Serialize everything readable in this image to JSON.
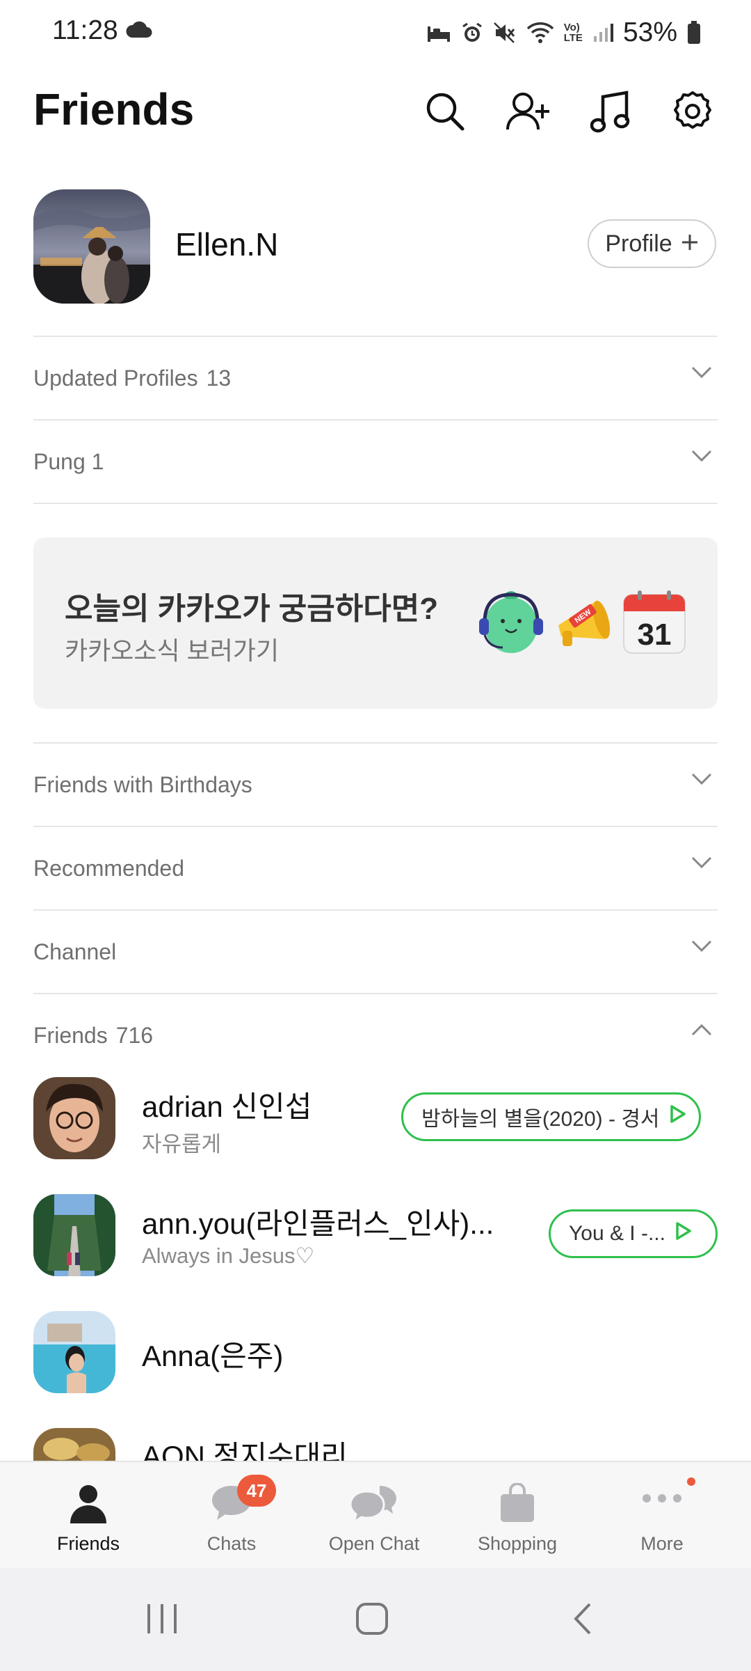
{
  "status_bar": {
    "time": "11:28",
    "battery_percent": "53%",
    "icons": [
      "cloud-icon",
      "sleep-icon",
      "alarm-icon",
      "mute-icon",
      "wifi-icon",
      "volte-icon",
      "signal-icon",
      "battery-icon"
    ],
    "volte_text": "VoLTE"
  },
  "header": {
    "title": "Friends",
    "actions": [
      "search-icon",
      "add-friend-icon",
      "music-icon",
      "settings-icon"
    ]
  },
  "my_profile": {
    "name": "Ellen.N",
    "profile_button_label": "Profile"
  },
  "sections": {
    "updated_profiles": {
      "label": "Updated Profiles",
      "count": "13"
    },
    "pung": {
      "label": "Pung 1"
    },
    "birthdays": {
      "label": "Friends with Birthdays"
    },
    "recommended": {
      "label": "Recommended"
    },
    "channel": {
      "label": "Channel"
    },
    "friends": {
      "label": "Friends",
      "count": "716"
    }
  },
  "banner": {
    "title": "오늘의 카카오가 궁금하다면?",
    "subtitle": "카카오소식 보러가기",
    "new_badge": "NEW",
    "calendar_day": "31"
  },
  "friends": [
    {
      "name": "adrian 신인섭",
      "status": "자유롭게",
      "music": "밤하늘의 별을(2020) - 경서"
    },
    {
      "name": "ann.you(라인플러스_인사)...",
      "status": "Always in Jesus♡",
      "music": "You & I -..."
    },
    {
      "name": "Anna(은주)",
      "status": "",
      "music": ""
    },
    {
      "name": "AON 정지수대리",
      "status": "",
      "music": ""
    }
  ],
  "bottom_nav": {
    "items": [
      {
        "label": "Friends"
      },
      {
        "label": "Chats",
        "badge": "47"
      },
      {
        "label": "Open Chat"
      },
      {
        "label": "Shopping"
      },
      {
        "label": "More"
      }
    ]
  },
  "colors": {
    "accent_green": "#2ec04c",
    "badge_red": "#ec5a3c",
    "banner_bg": "#f2f2f2"
  }
}
